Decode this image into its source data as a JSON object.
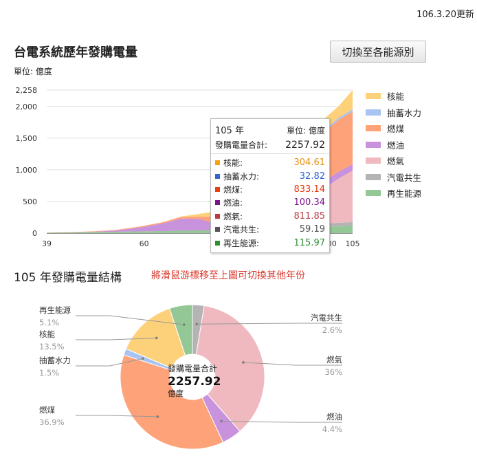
{
  "header": {
    "updated": "106.3.20更新",
    "title": "台電系統歷年發購電量",
    "unit": "單位: 億度",
    "switch_button": "切換至各能源別"
  },
  "colors": {
    "nuclear": "#fdd17a",
    "pumped": "#a9c4f2",
    "coal": "#fea279",
    "oil": "#c892dd",
    "gas": "#f0b9bf",
    "cogen": "#b4b4b4",
    "renewable": "#93c795",
    "tooltip_nuclear": "#ea8f0c",
    "tooltip_pumped": "#2f5fd9",
    "tooltip_coal": "#e2370b",
    "tooltip_oil": "#7a168a",
    "tooltip_gas": "#bb3b3f",
    "tooltip_cogen": "#555555",
    "tooltip_renewable": "#2e8d2f",
    "hint": "#d9352a"
  },
  "tooltip": {
    "year": "105",
    "year_suffix": "年",
    "unit": "單位: 億度",
    "total_label": "發購電量合計:",
    "total_value": "2257.92",
    "rows": [
      {
        "label": "核能:",
        "value": "304.61",
        "color": "#f6a20d",
        "text_color": "#ea8f0c"
      },
      {
        "label": "抽蓄水力:",
        "value": "32.82",
        "color": "#3366cc",
        "text_color": "#2f5fd9"
      },
      {
        "label": "燃煤:",
        "value": "833.14",
        "color": "#e8410f",
        "text_color": "#e2370b"
      },
      {
        "label": "燃油:",
        "value": "100.34",
        "color": "#7a168a",
        "text_color": "#7a168a"
      },
      {
        "label": "燃氣:",
        "value": "811.85",
        "color": "#bb3b3f",
        "text_color": "#bb3b3f"
      },
      {
        "label": "汽電共生:",
        "value": "59.19",
        "color": "#555555",
        "text_color": "#555555"
      },
      {
        "label": "再生能源:",
        "value": "115.97",
        "color": "#2e8d2f",
        "text_color": "#2e8d2f"
      }
    ]
  },
  "chart_data": [
    {
      "type": "area",
      "title": "台電系統歷年發購電量",
      "ylabel": "單位: 億度",
      "ylim": [
        0,
        2258
      ],
      "y_ticks": [
        "0",
        "500",
        "1,000",
        "1,500",
        "2,000",
        "2,258"
      ],
      "x_ticks": [
        "39",
        "60",
        "80",
        "100",
        "105"
      ],
      "x": [
        39,
        44,
        49,
        54,
        59,
        64,
        68,
        72,
        75,
        78,
        81,
        84,
        87,
        90,
        93,
        96,
        99,
        102,
        105
      ],
      "stacked": true,
      "legend_position": "right",
      "series": [
        {
          "name": "再生能源",
          "values": [
            9,
            12,
            17,
            22,
            28,
            33,
            40,
            45,
            48,
            50,
            55,
            60,
            62,
            70,
            75,
            85,
            95,
            105,
            116
          ]
        },
        {
          "name": "汽電共生",
          "values": [
            0,
            0,
            0,
            0,
            0,
            0,
            0,
            0,
            0,
            0,
            0,
            0,
            20,
            40,
            50,
            55,
            58,
            58,
            59
          ]
        },
        {
          "name": "燃氣",
          "values": [
            0,
            0,
            0,
            0,
            0,
            0,
            0,
            0,
            0,
            0,
            0,
            10,
            50,
            120,
            250,
            380,
            560,
            700,
            812
          ]
        },
        {
          "name": "燃油",
          "values": [
            0,
            1,
            5,
            20,
            60,
            120,
            190,
            180,
            110,
            90,
            100,
            130,
            170,
            180,
            160,
            140,
            110,
            110,
            100
          ]
        },
        {
          "name": "燃煤",
          "values": [
            2,
            4,
            6,
            10,
            15,
            20,
            25,
            40,
            100,
            150,
            200,
            250,
            320,
            450,
            580,
            700,
            780,
            820,
            833
          ]
        },
        {
          "name": "抽蓄水力",
          "values": [
            0,
            0,
            0,
            0,
            0,
            0,
            0,
            0,
            0,
            0,
            0,
            5,
            12,
            20,
            25,
            30,
            30,
            32,
            33
          ]
        },
        {
          "name": "核能",
          "values": [
            0,
            0,
            0,
            0,
            0,
            0,
            8,
            40,
            80,
            100,
            120,
            145,
            160,
            170,
            175,
            180,
            180,
            180,
            305
          ]
        }
      ]
    },
    {
      "type": "pie",
      "title": "105 年發購電量結構",
      "center_label": "發購電量合計",
      "center_value": "2257.92",
      "center_unit": "億度",
      "slices": [
        {
          "name": "汽電共生",
          "value": 59.19,
          "percent": "2.6%"
        },
        {
          "name": "燃氣",
          "value": 811.85,
          "percent": "36%"
        },
        {
          "name": "燃油",
          "value": 100.34,
          "percent": "4.4%"
        },
        {
          "name": "燃煤",
          "value": 833.14,
          "percent": "36.9%"
        },
        {
          "name": "抽蓄水力",
          "value": 32.82,
          "percent": "1.5%"
        },
        {
          "name": "核能",
          "value": 304.61,
          "percent": "13.5%"
        },
        {
          "name": "再生能源",
          "value": 115.97,
          "percent": "5.1%"
        }
      ]
    }
  ],
  "legend": [
    "核能",
    "抽蓄水力",
    "燃煤",
    "燃油",
    "燃氣",
    "汽電共生",
    "再生能源"
  ],
  "section": {
    "title": "105 年發購電量結構",
    "hint": "將滑鼠游標移至上圖可切換其他年份"
  }
}
